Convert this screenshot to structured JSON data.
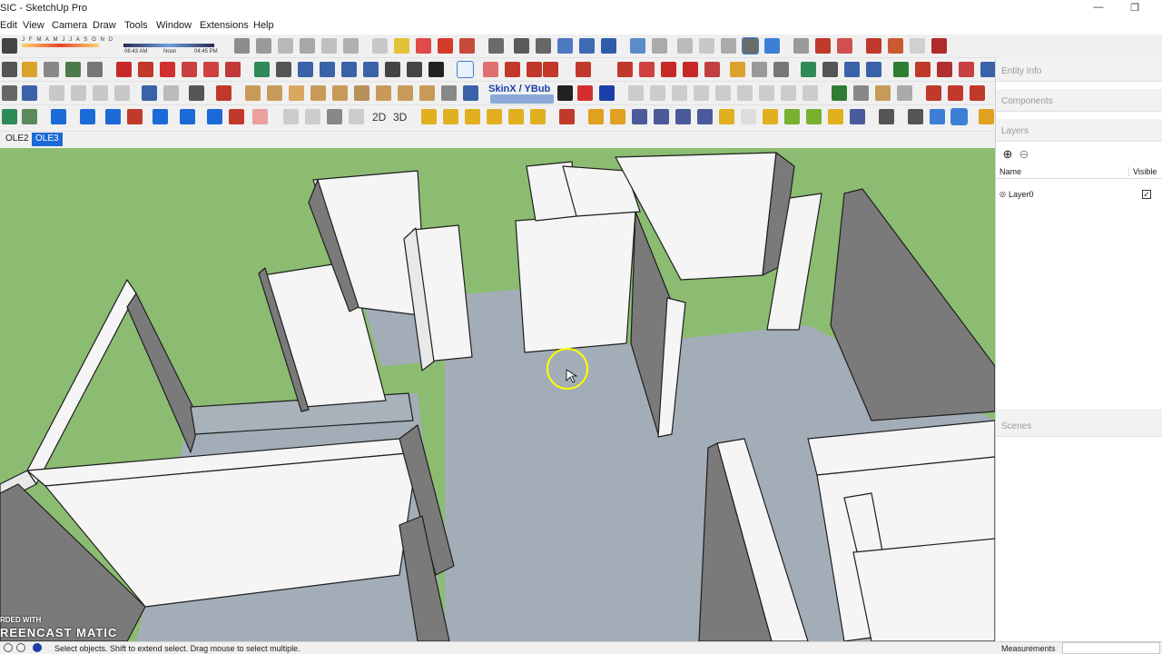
{
  "window": {
    "title": "SIC - SketchUp Pro"
  },
  "menus": [
    "Edit",
    "View",
    "Camera",
    "Draw",
    "Tools",
    "Window",
    "Extensions",
    "Help"
  ],
  "shadow_bar": {
    "months": "J F M A M J J A S O N D",
    "time_start": "06:43 AM",
    "time_mid": "Noon",
    "time_end": "04:45 PM"
  },
  "toolbar_text": {
    "skin_label": "SkinX / YBub",
    "view_2d": "2D",
    "view_3d": "3D"
  },
  "scene_tabs": [
    {
      "label": "OLE2",
      "active": false
    },
    {
      "label": "OLE3",
      "active": true
    }
  ],
  "tray": {
    "entity_info": "Entity Info",
    "components": "Components",
    "layers": "Layers",
    "layers_col_name": "Name",
    "layers_col_visible": "Visible",
    "layers_rows": [
      {
        "name": "Layer0",
        "visible": true
      }
    ],
    "scenes": "Scenes"
  },
  "watermark": {
    "line1": "RDED WITH",
    "line2": "REENCAST",
    "line3": "MATIC"
  },
  "status": {
    "message": "Select objects. Shift to extend select. Drag mouse to select multiple.",
    "measurements_label": "Measurements"
  },
  "colors": {
    "ground": "#8cbc72",
    "floor": "#a3adb7",
    "wall_lit": "#f5f5f5",
    "wall_shade": "#7a7a7a",
    "selected_tab": "#1b6ad8"
  }
}
